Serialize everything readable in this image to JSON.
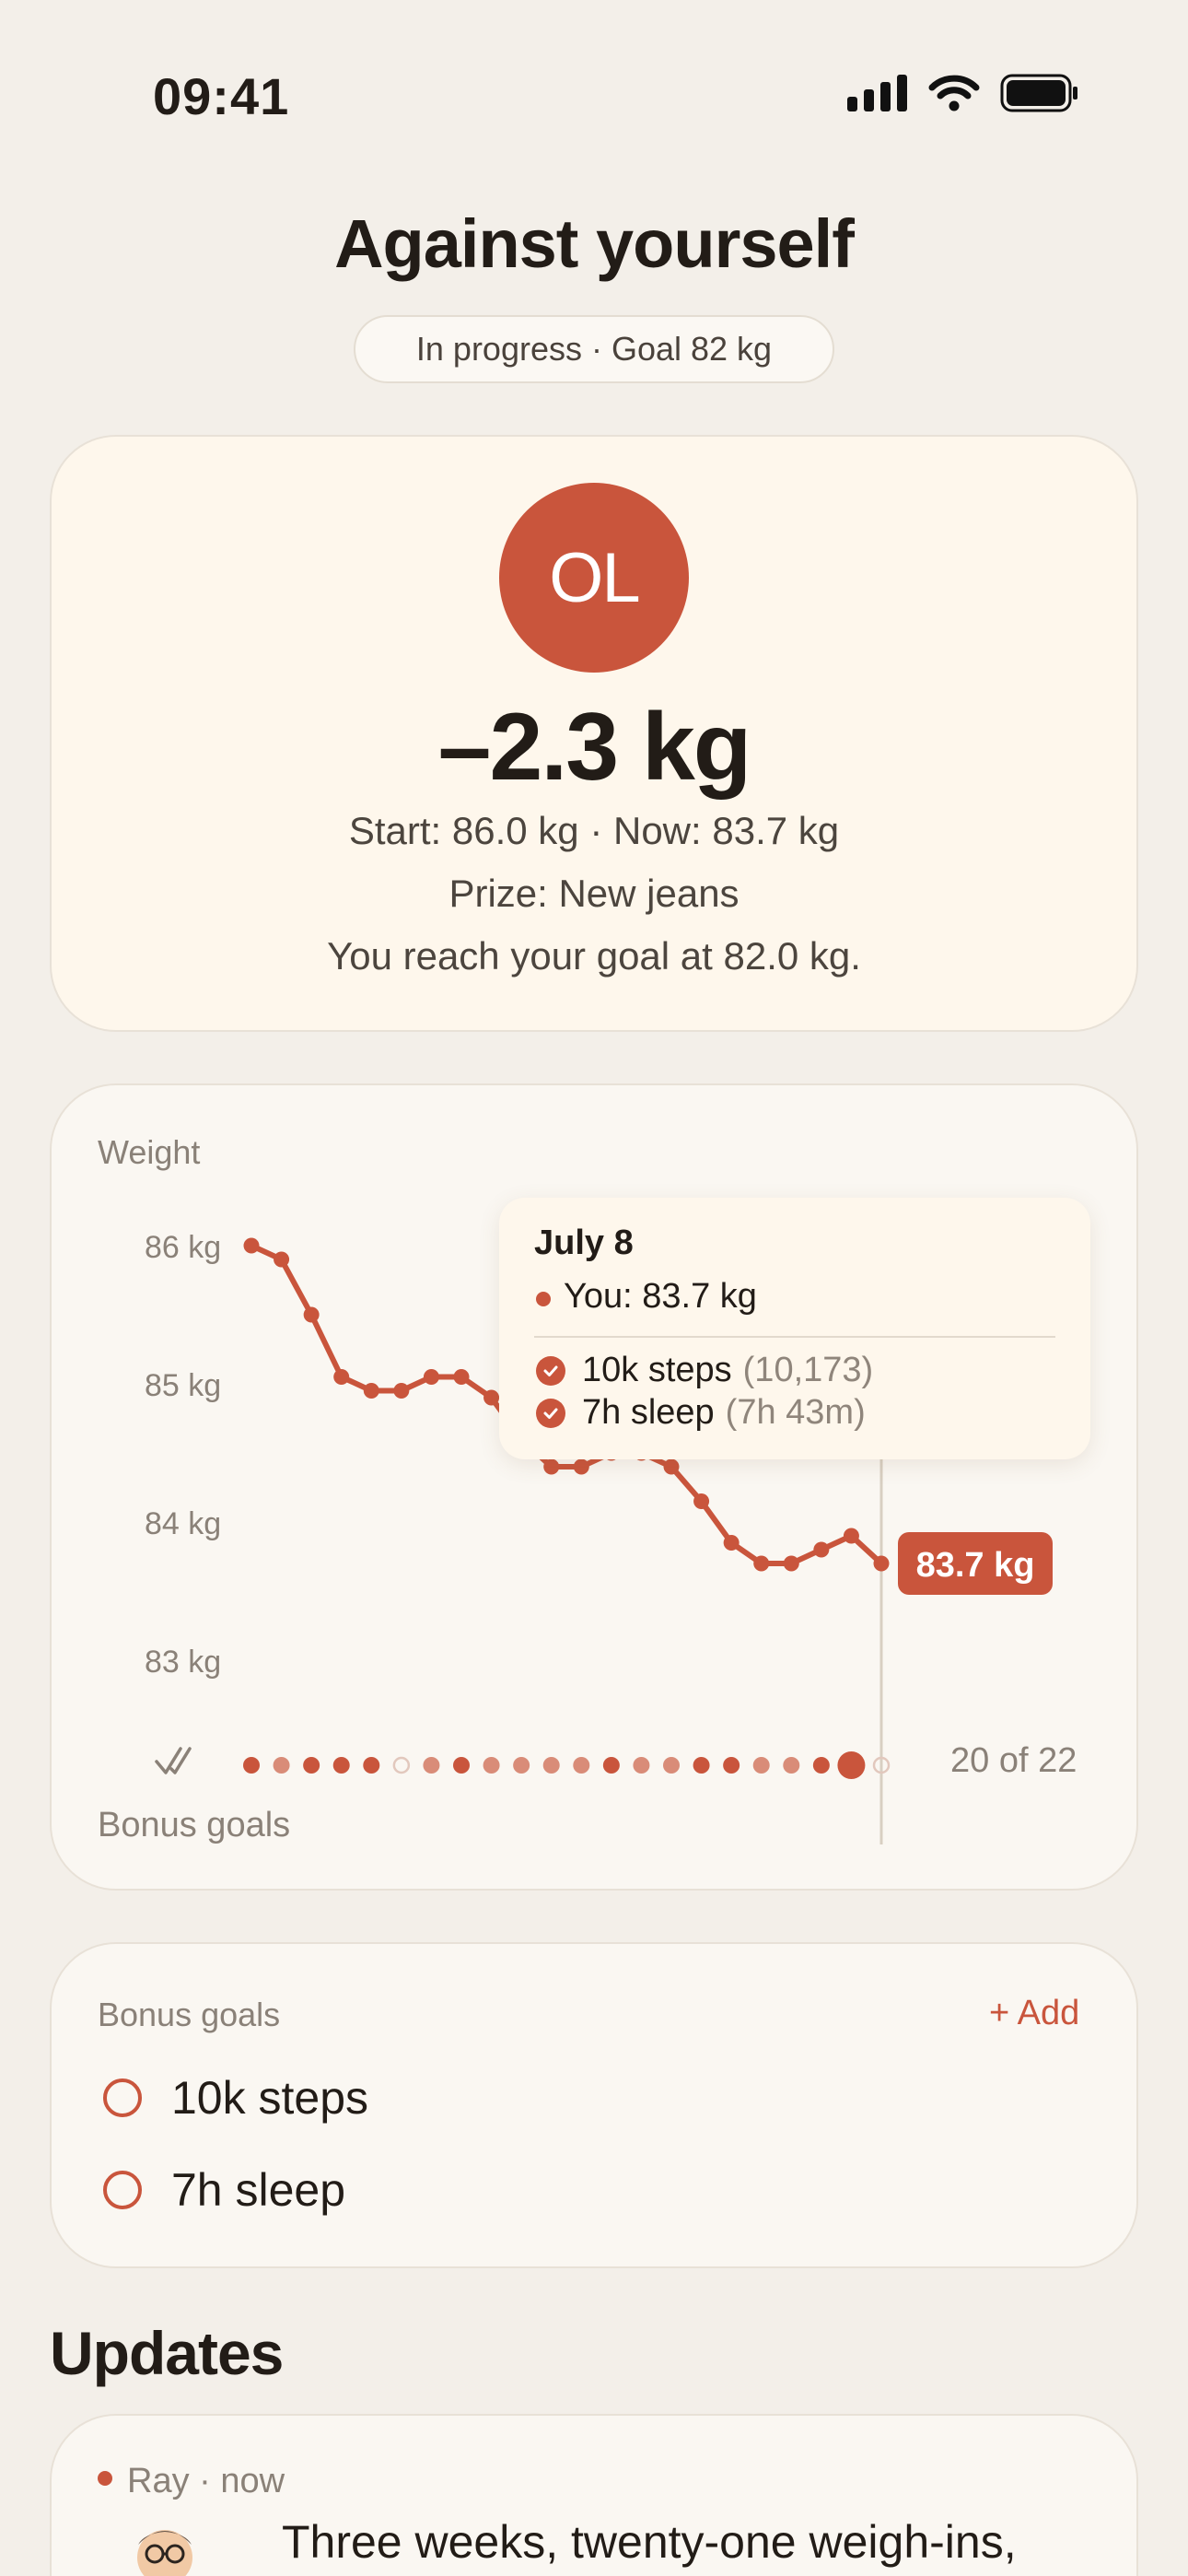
{
  "status_bar": {
    "time": "09:41"
  },
  "header": {
    "title": "Against yourself",
    "status_pill": "In progress · Goal 82 kg"
  },
  "hero": {
    "avatar_initials": "OL",
    "delta": "–2.3 kg",
    "start_now": "Start: 86.0 kg · Now: 83.7 kg",
    "prize": "Prize: New jeans",
    "goal_text": "You reach your goal at 82.0 kg."
  },
  "chart_card": {
    "title": "Weight",
    "bonus_label": "Bonus goals",
    "streak_count": "20 of 22",
    "tooltip": {
      "date": "July 8",
      "you": "You: 83.7 kg",
      "rows": [
        {
          "label": "10k steps",
          "detail": "(10,173)"
        },
        {
          "label": "7h sleep",
          "detail": "(7h 43m)"
        }
      ]
    }
  },
  "chart_data": {
    "type": "line",
    "title": "Weight",
    "y_ticks": [
      "86 kg",
      "85 kg",
      "84 kg",
      "83 kg"
    ],
    "ylim": [
      82.55,
      86.25
    ],
    "series": [
      {
        "values": [
          86.0,
          85.9,
          85.5,
          85.05,
          84.95,
          84.95,
          85.05,
          85.05,
          84.9,
          84.6,
          84.4,
          84.4,
          84.5,
          84.5,
          84.4,
          84.15,
          83.85,
          83.7,
          83.7,
          83.8,
          83.9,
          83.7
        ]
      }
    ],
    "current_label": "83.7 kg",
    "bonus_goal_days": [
      "full",
      "half",
      "full",
      "full",
      "full",
      "miss",
      "half",
      "full",
      "half",
      "half",
      "half",
      "half",
      "full",
      "half",
      "half",
      "full",
      "full",
      "half",
      "half",
      "full",
      "full",
      "miss"
    ],
    "colors": {
      "line": "#c9553c",
      "partial": "#d98c78",
      "grid_cursor": "#d8cfc2"
    }
  },
  "bonus_goals": {
    "title": "Bonus goals",
    "add_label": "+ Add",
    "items": [
      {
        "label": "10k steps"
      },
      {
        "label": "7h sleep"
      }
    ]
  },
  "updates": {
    "title": "Updates",
    "items": [
      {
        "author": "Ray",
        "time": "now",
        "text": "Three weeks, twenty-one weigh-ins,"
      }
    ]
  }
}
